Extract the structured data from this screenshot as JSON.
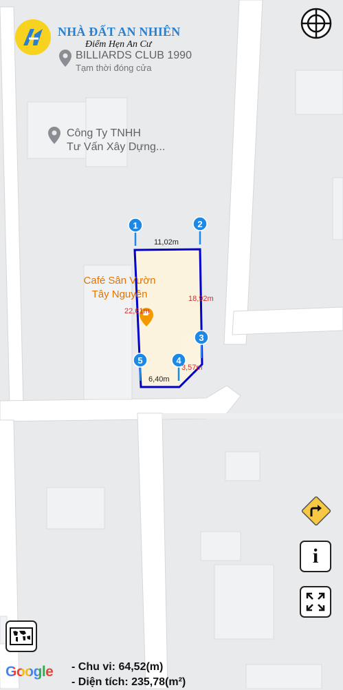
{
  "brand": {
    "title": "NHÀ ĐẤT AN NHIÊN",
    "subtitle": "Điểm Hẹn An Cư"
  },
  "pois": {
    "billiards": {
      "name": "BILLIARDS CLUB 1990",
      "status": "Tạm thời đóng cửa"
    },
    "company": {
      "line1": "Công Ty TNHH",
      "line2": "Tư Vấn Xây Dựng..."
    },
    "cafe": {
      "line1": "Café Sân Vườn",
      "line2": "Tây Nguyên"
    }
  },
  "markers": [
    "1",
    "2",
    "3",
    "4",
    "5"
  ],
  "dimensions": {
    "side_1_2": "11,02m",
    "side_2_3": "18,92m",
    "side_3_4": "3,57m",
    "side_4_5": "6,40m",
    "side_5_1": "22,61m"
  },
  "controls": {
    "info_label": "i"
  },
  "summary": {
    "perimeter": "- Chu vi: 64,52(m)",
    "area": "- Diện tích: 235,78(m²)"
  },
  "attribution": {
    "google": "Google"
  },
  "colors": {
    "boundary": "#0000c8",
    "marker": "#1e88e5",
    "dimension_text": "#d32f2f",
    "cafe_poi": "#e37400",
    "brand_blue": "#2a7fcf"
  }
}
